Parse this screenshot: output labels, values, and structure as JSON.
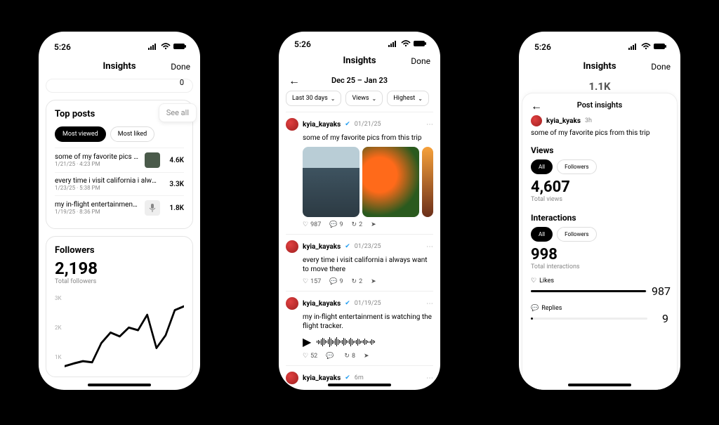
{
  "status": {
    "time": "5:26"
  },
  "phone1": {
    "title": "Insights",
    "done": "Done",
    "ghost_zero": "0",
    "top_posts": {
      "title": "Top posts",
      "see_all": "See all",
      "tabs": {
        "most_viewed": "Most viewed",
        "most_liked": "Most liked"
      },
      "rows": [
        {
          "title": "some of my favorite pics fro…",
          "sub": "1/21/25 · 4:23 PM",
          "count": "4.6K",
          "thumb": "image"
        },
        {
          "title": "every time i visit california i always w…",
          "sub": "1/23/25 · 5:38 PM",
          "count": "3.3K",
          "thumb": "none"
        },
        {
          "title": "my in-flight entertainment is…",
          "sub": "1/19/25 · 8:36 PM",
          "count": "1.8K",
          "thumb": "mic"
        }
      ]
    },
    "followers": {
      "title": "Followers",
      "value": "2,198",
      "sub": "Total followers",
      "yticks": [
        "3K",
        "2K",
        "1K"
      ]
    }
  },
  "phone2": {
    "title": "Insights",
    "done": "Done",
    "date_range": "Dec 25 – Jan 23",
    "filters": {
      "range": "Last 30 days",
      "sort1": "Views",
      "sort2": "Highest"
    },
    "posts": [
      {
        "user": "kyia_kayaks",
        "date": "01/21/25",
        "text": "some of my favorite pics from this trip",
        "media": true,
        "actions": {
          "likes": "987",
          "comments": "9",
          "reposts": "2"
        }
      },
      {
        "user": "kyia_kayaks",
        "date": "01/23/25",
        "text": "every time i visit california i always want to move there",
        "media": false,
        "actions": {
          "likes": "157",
          "comments": "9",
          "reposts": "2"
        }
      },
      {
        "user": "kyia_kayaks",
        "date": "01/19/25",
        "text": "my in-flight entertainment is watching the flight tracker.",
        "audio": true,
        "actions": {
          "likes": "52",
          "comments": "",
          "reposts": "8"
        }
      },
      {
        "user": "kyia_kayaks",
        "date": "6m"
      }
    ]
  },
  "phone3": {
    "title": "Insights",
    "done": "Done",
    "ghost_value": "1.1K",
    "sheet_title": "Post insights",
    "user": "kyia_kyaks",
    "age": "3h",
    "caption": "some of my favorite pics from this trip",
    "views": {
      "title": "Views",
      "tabs": {
        "all": "All",
        "followers": "Followers"
      },
      "value": "4,607",
      "sub": "Total views"
    },
    "interactions": {
      "title": "Interactions",
      "tabs": {
        "all": "All",
        "followers": "Followers"
      },
      "value": "998",
      "sub": "Total interactions",
      "likes_label": "Likes",
      "likes_value": "987",
      "replies_label": "Replies",
      "replies_value": "9"
    }
  },
  "chart_data": {
    "type": "line",
    "title": "Followers",
    "ylabel": "",
    "ylim": [
      1000,
      3000
    ],
    "yticks": [
      1000,
      2000,
      3000
    ],
    "x": [
      0,
      1,
      2,
      3,
      4,
      5,
      6,
      7,
      8,
      9,
      10,
      11,
      12,
      13
    ],
    "values": [
      1050,
      1120,
      1180,
      1150,
      1650,
      1920,
      1820,
      2050,
      1980,
      2380,
      1520,
      1850,
      2500,
      2600
    ]
  }
}
